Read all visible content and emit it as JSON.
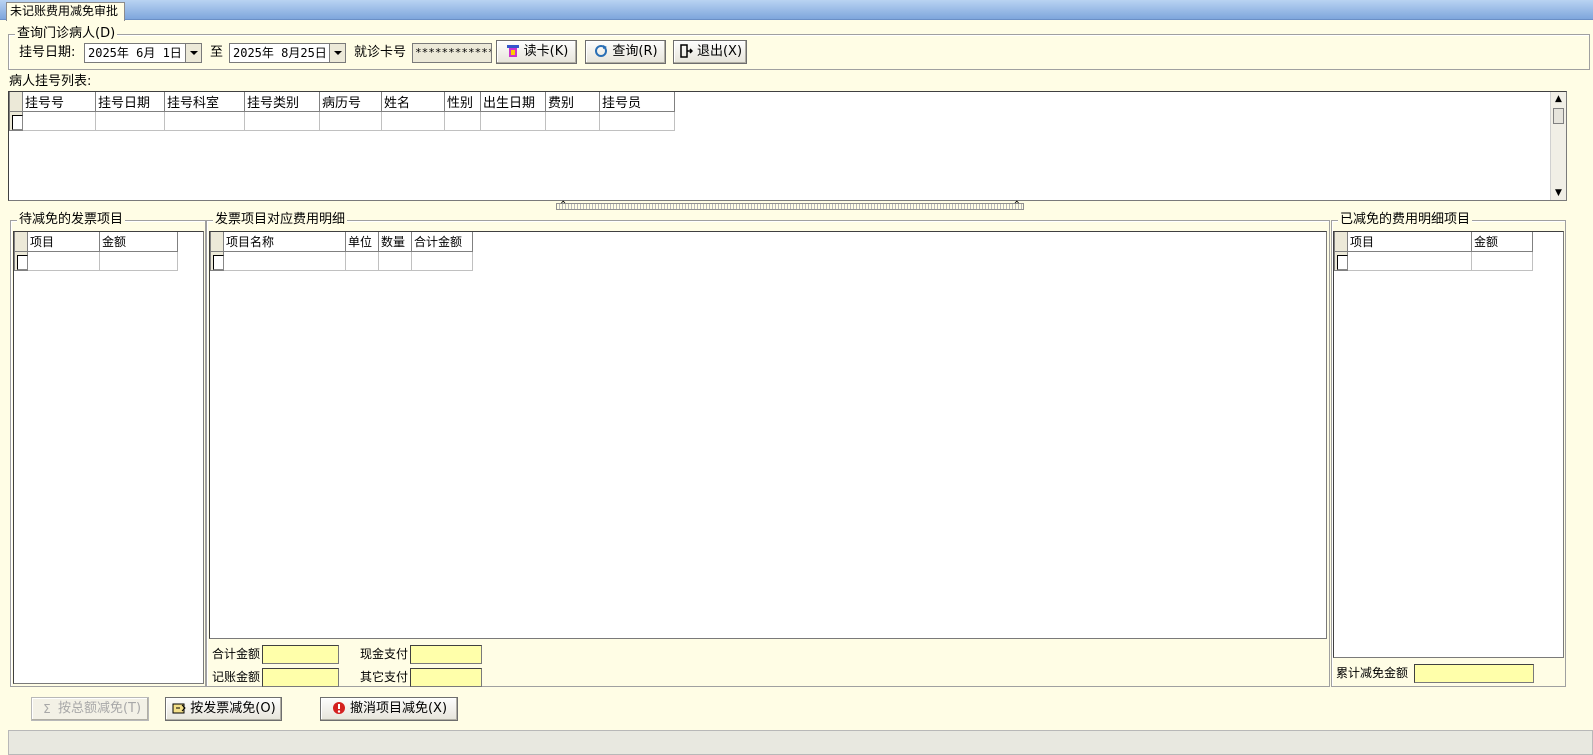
{
  "window": {
    "tab_title": "未记账费用减免审批"
  },
  "query": {
    "group_title": "查询门诊病人(D)",
    "reg_date_label": "挂号日期:",
    "date_from": "2025年 6月 1日",
    "to_label": "至",
    "date_to": "2025年 8月25日",
    "card_label": "就诊卡号",
    "card_value": "*************",
    "read_card_label": "读卡(K)",
    "search_label": "查询(R)",
    "exit_label": "退出(X)"
  },
  "patient_list": {
    "title": "病人挂号列表:",
    "columns": [
      "挂号号",
      "挂号日期",
      "挂号科室",
      "挂号类别",
      "病历号",
      "姓名",
      "性别",
      "出生日期",
      "费别",
      "挂号员"
    ]
  },
  "pending_items": {
    "title": "待减免的发票项目",
    "columns": [
      "项目",
      "金额"
    ]
  },
  "invoice_detail": {
    "title": "发票项目对应费用明细",
    "columns": [
      "项目名称",
      "单位",
      "数量",
      "合计金额"
    ],
    "total_label": "合计金额",
    "cash_label": "现金支付",
    "account_label": "记账金额",
    "other_label": "其它支付"
  },
  "reduced_items": {
    "title": "已减免的费用明细项目",
    "columns": [
      "项目",
      "金额"
    ],
    "cumulative_label": "累计减免金额"
  },
  "actions": {
    "by_total_label": "按总额减免(T)",
    "by_invoice_label": "按发票减免(O)",
    "cancel_label": "撤消项目减免(X)"
  },
  "icons": {
    "read_card": "card-reader-icon",
    "search": "refresh-search-icon",
    "exit": "exit-door-icon",
    "sum": "sigma-icon",
    "invoice": "invoice-icon",
    "cancel": "cancel-icon"
  }
}
